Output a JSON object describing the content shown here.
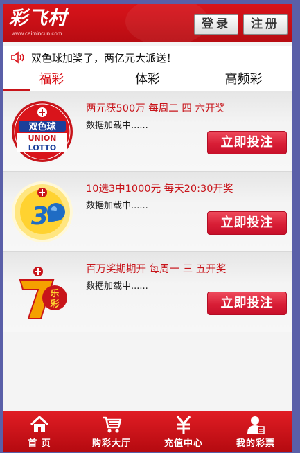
{
  "header": {
    "logo_text": "彩飞村",
    "logo_url": "www.caimincun.com",
    "login_label": "登录",
    "register_label": "注册"
  },
  "notice": {
    "text": "双色球加奖了，两亿元大派送！"
  },
  "tabs": [
    {
      "label": "福彩",
      "active": true
    },
    {
      "label": "体彩",
      "active": false
    },
    {
      "label": "高频彩",
      "active": false
    }
  ],
  "lotteries": [
    {
      "title": "两元获500万 每周二 四 六开奖",
      "status": "数据加载中......",
      "button": "立即投注",
      "logo_icon": "shuangseqiu-logo-icon"
    },
    {
      "title": "10选3中1000元 每天20:30开奖",
      "status": "数据加载中......",
      "button": "立即投注",
      "logo_icon": "3d-logo-icon"
    },
    {
      "title": "百万奖期期开 每周一 三 五开奖",
      "status": "数据加载中......",
      "button": "立即投注",
      "logo_icon": "qilecai-logo-icon"
    }
  ],
  "footer": [
    {
      "label": "首 页",
      "icon": "home-icon"
    },
    {
      "label": "购彩大厅",
      "icon": "cart-icon"
    },
    {
      "label": "充值中心",
      "icon": "yen-icon"
    },
    {
      "label": "我的彩票",
      "icon": "user-icon"
    }
  ],
  "colors": {
    "brand_red": "#d9141b",
    "frame": "#5a5fa8"
  }
}
